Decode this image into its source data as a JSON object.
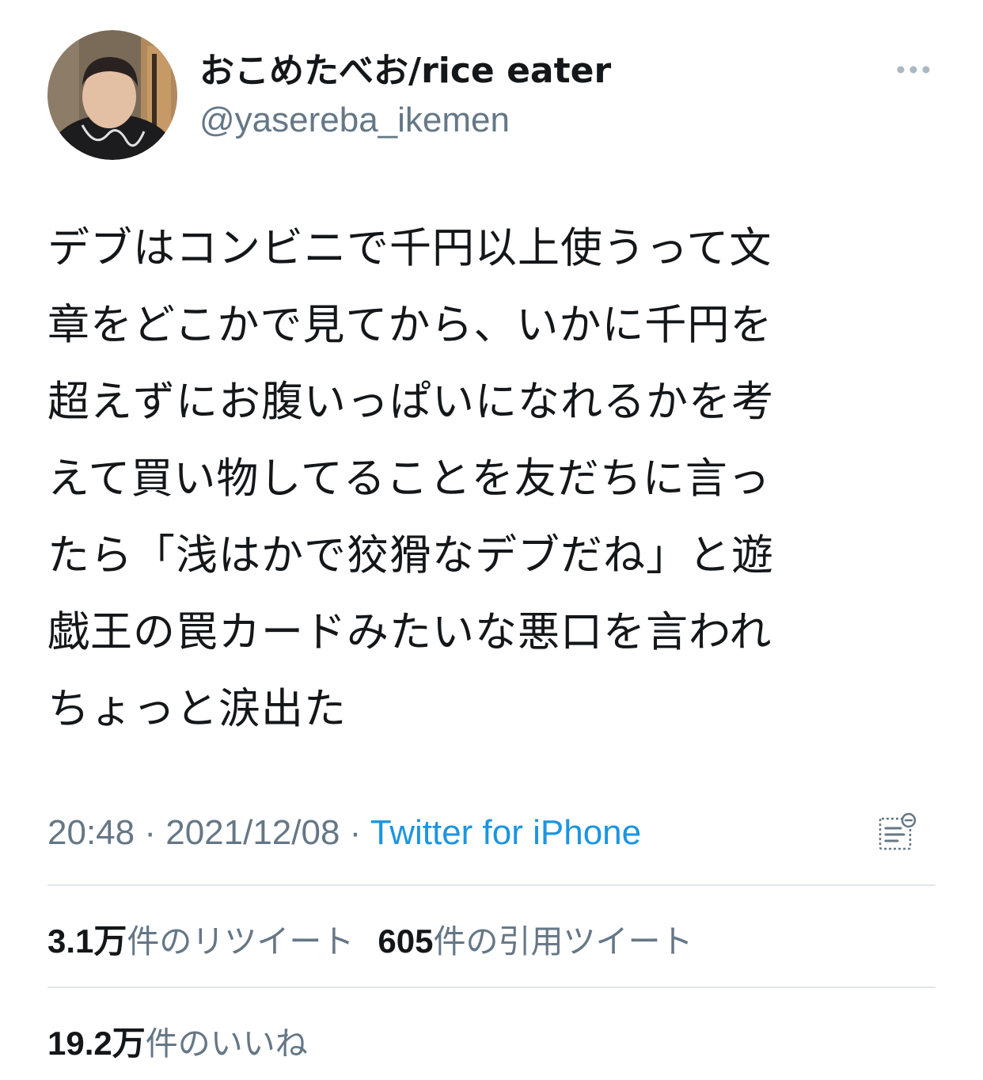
{
  "author": {
    "display_name": "おこめたべお/rice eater",
    "handle": "@yasereba_ikemen"
  },
  "tweet": {
    "lines": [
      "デブはコンビニで千円以上使うって文",
      "章をどこかで見てから、いかに千円を",
      "超えずにお腹いっぱいになれるかを考",
      "えて買い物してることを友だちに言っ",
      "たら「浅はかで狡猾なデブだね」と遊",
      "戯王の罠カードみたいな悪口を言われ",
      "ちょっと涙出た"
    ]
  },
  "meta": {
    "time": "20:48",
    "separator": " · ",
    "date": "2021/12/08",
    "source": "Twitter for iPhone"
  },
  "stats": {
    "retweets": {
      "count": "3.1万",
      "label": "件のリツイート"
    },
    "quotes": {
      "count": "605",
      "label": "件の引用ツイート"
    },
    "likes": {
      "count": "19.2万",
      "label": "件のいいね"
    }
  },
  "icons": {
    "more": "more-horizontal-icon",
    "activity": "view-activity-icon"
  },
  "colors": {
    "text": "#14171a",
    "secondary": "#657786",
    "link": "#1b95e0",
    "divider": "#e1e8ed"
  }
}
